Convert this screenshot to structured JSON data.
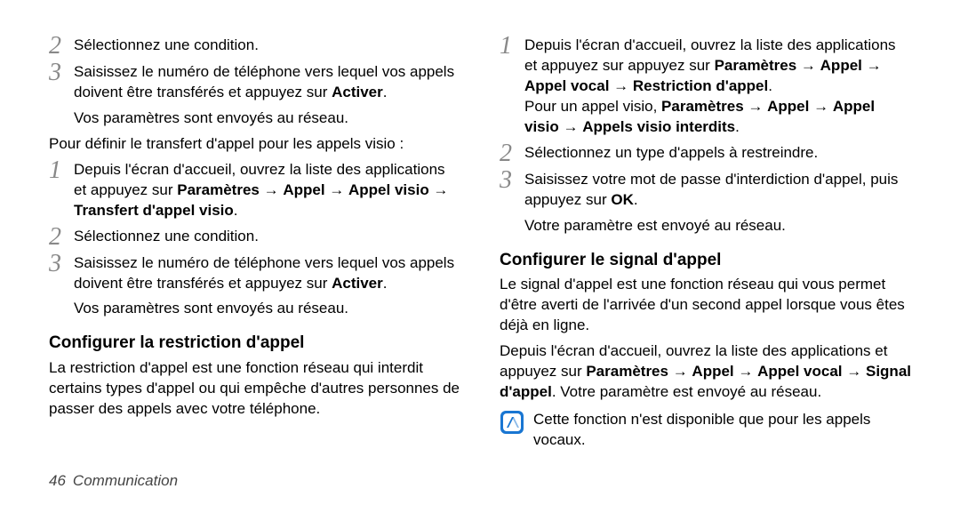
{
  "left": {
    "item1_num": "2",
    "item1_text": "Sélectionnez une condition.",
    "item2_num": "3",
    "item2_a": "Saisissez le numéro de téléphone vers lequel vos appels doivent être transférés et appuyez sur ",
    "item2_bold": "Activer",
    "item2_b": ".",
    "item2_result": "Vos paramètres sont envoyés au réseau.",
    "intro2": "Pour définir le transfert d'appel pour les appels visio :",
    "item3_num": "1",
    "item3_a": "Depuis l'écran d'accueil, ouvrez la liste des applications et  appuyez sur ",
    "item3_b1": "Paramètres",
    "item3_arrow": " → ",
    "item3_b2": "Appel",
    "item3_b3": "Appel visio",
    "item3_b4": "Transfert d'appel visio",
    "item3_end": ".",
    "item4_num": "2",
    "item4_text": "Sélectionnez une condition.",
    "item5_num": "3",
    "item5_a": "Saisissez le numéro de téléphone vers lequel vos appels doivent être transférés et appuyez sur ",
    "item5_bold": "Activer",
    "item5_b": ".",
    "item5_result": "Vos paramètres sont envoyés au réseau.",
    "h3a": "Configurer la restriction d'appel",
    "p_h3a": "La restriction d'appel est une fonction réseau qui interdit certains types d'appel ou qui empêche d'autres personnes de passer des appels avec votre téléphone."
  },
  "right": {
    "item1_num": "1",
    "item1_a": "Depuis l'écran d'accueil, ouvrez la liste des applications et appuyez sur  appuyez sur ",
    "item1_b1": "Paramètres",
    "item1_arrow": " → ",
    "item1_b2": "Appel",
    "item1_b3": "Appel vocal",
    "item1_b4": "Restriction d'appel",
    "item1_end": ".",
    "item1_line2a": "Pour un appel visio,  ",
    "item1_l2_b1": "Paramètres",
    "item1_l2_b2": "Appel",
    "item1_l2_b3": "Appel visio",
    "item1_l2_b4": "Appels visio interdits",
    "item1_l2_end": ".",
    "item2_num": "2",
    "item2_text": "Sélectionnez un type d'appels à restreindre.",
    "item3_num": "3",
    "item3_a": "Saisissez votre mot de passe d'interdiction d'appel, puis appuyez sur ",
    "item3_bold": "OK",
    "item3_b": ".",
    "item3_result": "Votre paramètre est envoyé au réseau.",
    "h3b": "Configurer le signal d'appel",
    "p_h3b": "Le signal d'appel est une fonction réseau qui vous permet d'être averti de l'arrivée d'un second appel lorsque vous êtes déjà en ligne.",
    "p2_a": "Depuis l'écran d'accueil, ouvrez la liste des applications et appuyez sur ",
    "p2_b1": "Paramètres",
    "p2_b2": "Appel",
    "p2_b3": "Appel vocal",
    "p2_b4": "Signal d'appel",
    "p2_mid": ". Votre paramètre est envoyé au réseau.",
    "note_text": "Cette fonction n'est disponible que pour les appels vocaux."
  },
  "footer": {
    "page": "46",
    "section": "Communication"
  }
}
